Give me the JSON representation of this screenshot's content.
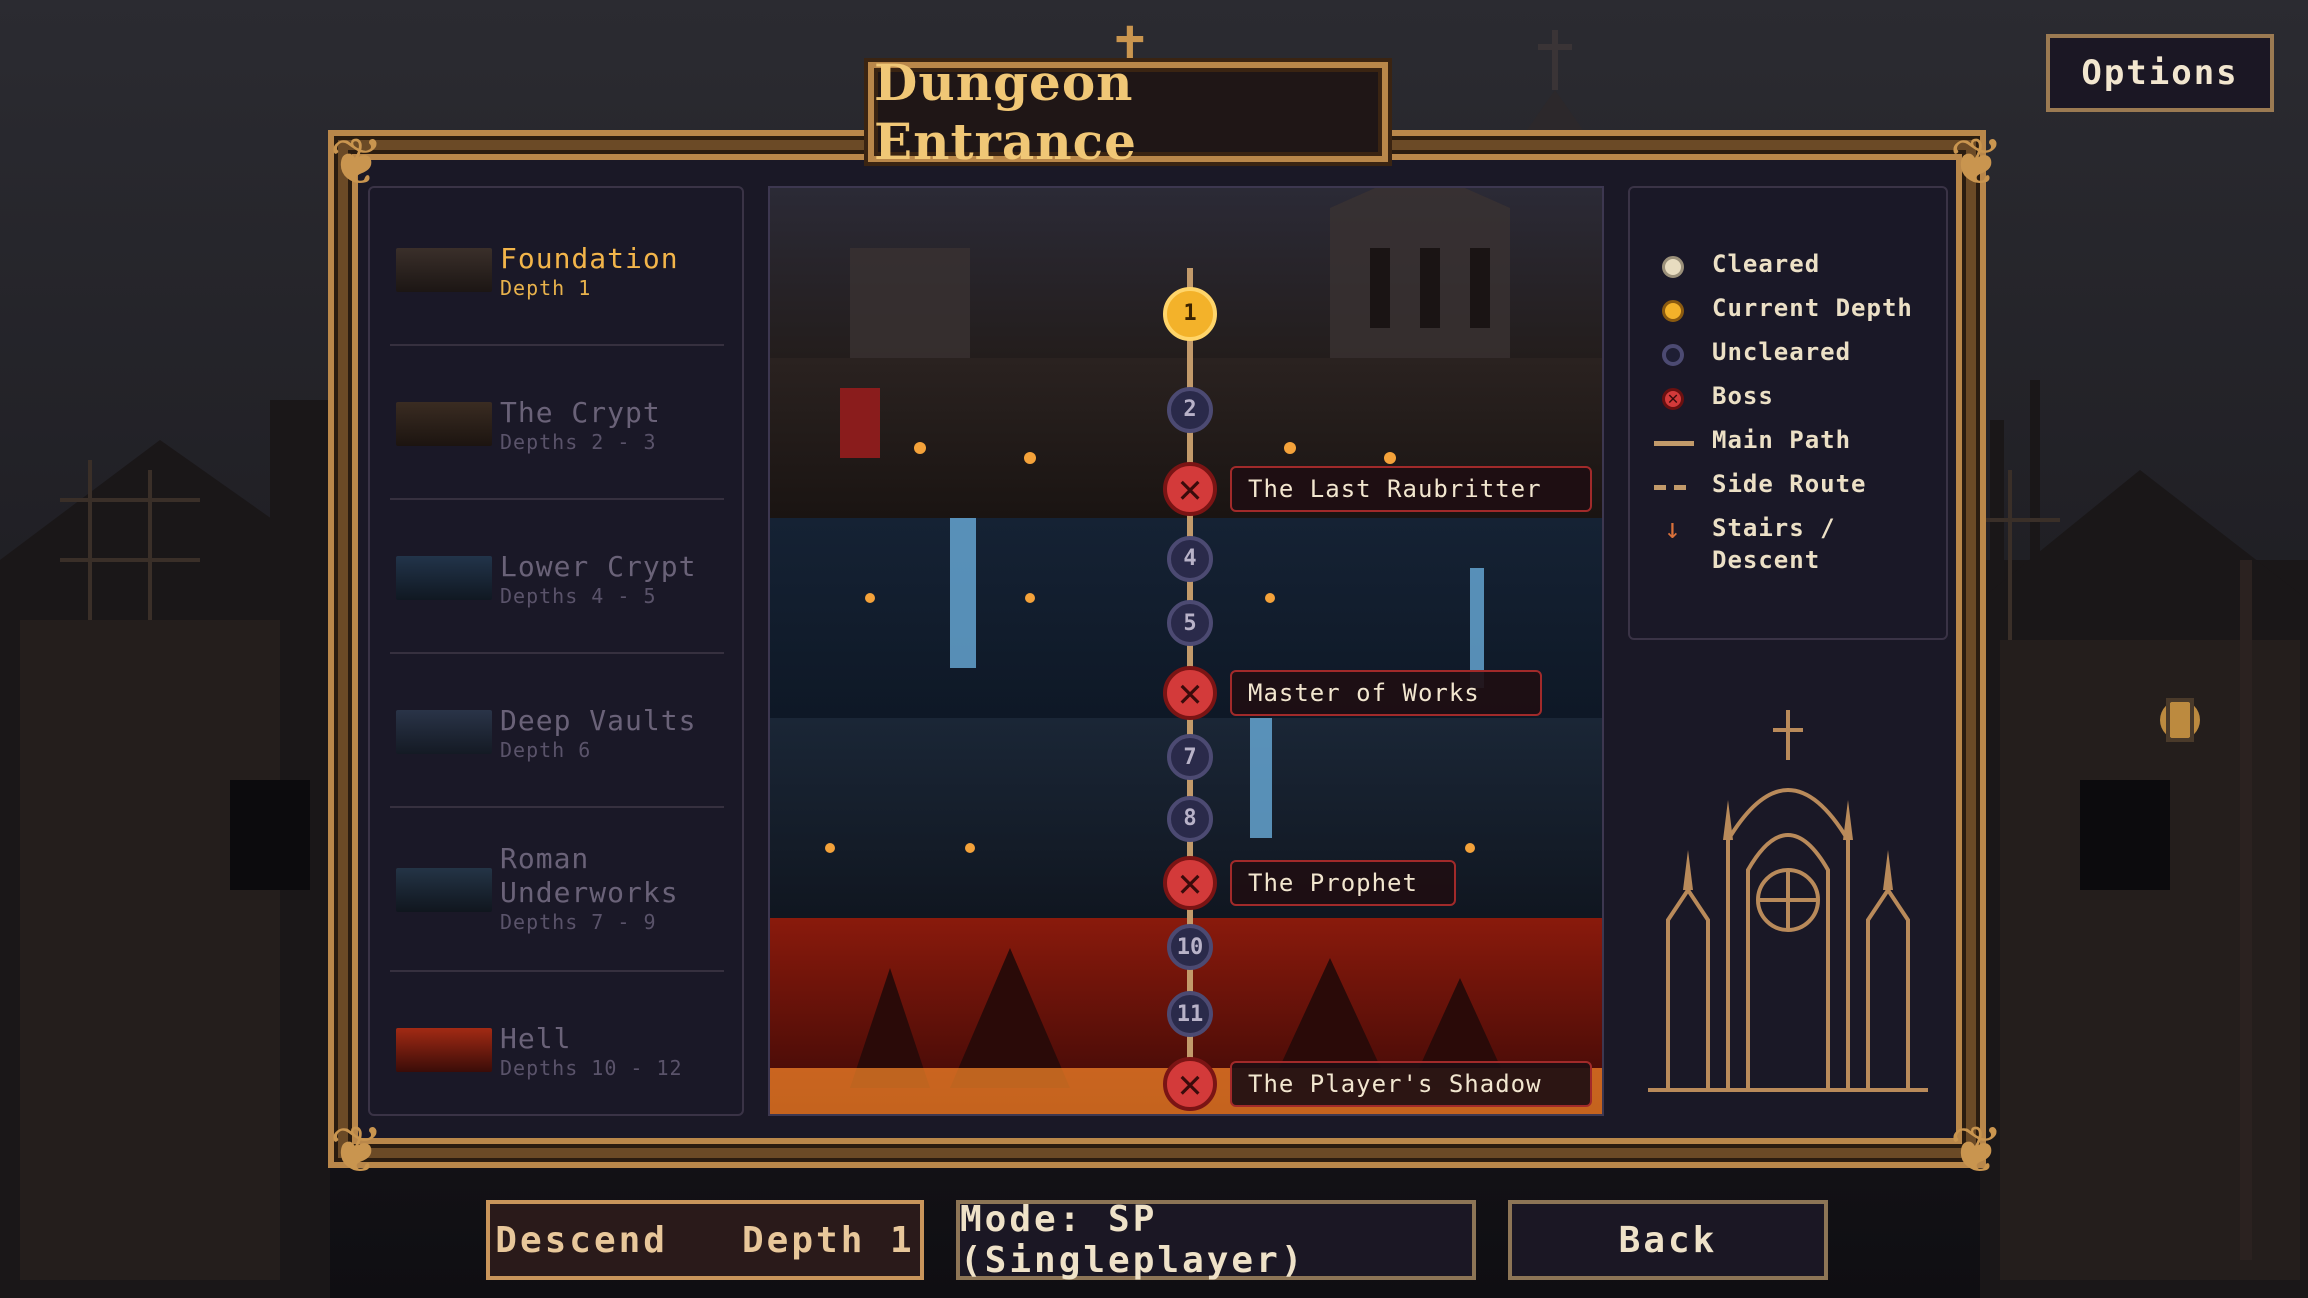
{
  "title": "Dungeon Entrance",
  "options_label": "Options",
  "regions": [
    {
      "name": "Foundation",
      "depth": "Depth 1",
      "active": true
    },
    {
      "name": "The Crypt",
      "depth": "Depths 2 - 3",
      "active": false
    },
    {
      "name": "Lower Crypt",
      "depth": "Depths 4 - 5",
      "active": false
    },
    {
      "name": "Deep Vaults",
      "depth": "Depth 6",
      "active": false
    },
    {
      "name": "Roman Underworks",
      "depth": "Depths 7 - 9",
      "active": false
    },
    {
      "name": "Hell",
      "depth": "Depths 10 - 12",
      "active": false
    }
  ],
  "map": {
    "nodes": [
      {
        "label": "1",
        "state": "current"
      },
      {
        "label": "2",
        "state": "uncleared"
      },
      {
        "label": "",
        "state": "boss",
        "boss_name": "The Last Raubritter"
      },
      {
        "label": "4",
        "state": "uncleared"
      },
      {
        "label": "5",
        "state": "uncleared"
      },
      {
        "label": "",
        "state": "boss",
        "boss_name": "Master of Works"
      },
      {
        "label": "7",
        "state": "uncleared"
      },
      {
        "label": "8",
        "state": "uncleared"
      },
      {
        "label": "",
        "state": "boss",
        "boss_name": "The Prophet"
      },
      {
        "label": "10",
        "state": "uncleared"
      },
      {
        "label": "11",
        "state": "uncleared"
      },
      {
        "label": "",
        "state": "boss",
        "boss_name": "The Player's Shadow"
      }
    ]
  },
  "legend": {
    "cleared": "Cleared",
    "current": "Current Depth",
    "uncleared": "Uncleared",
    "boss": "Boss",
    "main_path": "Main Path",
    "side_route": "Side Route",
    "stairs_1": "Stairs /",
    "stairs_2": "Descent"
  },
  "colors": {
    "current": "#f3b22a",
    "boss": "#d33a3a",
    "cleared": "#e8dcc0",
    "uncleared": "#4c4a72",
    "main_path": "#c29a6a",
    "stairs": "#d9703a"
  },
  "buttons": {
    "descend": "Descend   Depth 1",
    "mode": "Mode: SP (Singleplayer)",
    "back": "Back"
  }
}
